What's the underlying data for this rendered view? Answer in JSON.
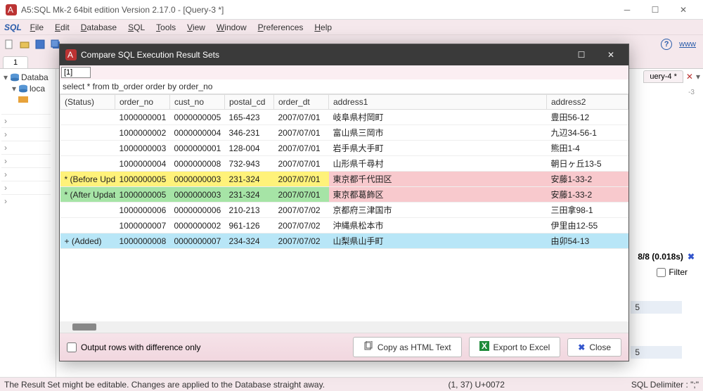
{
  "window": {
    "title": "A5:SQL Mk-2 64bit edition Version 2.17.0 - [Query-3 *]"
  },
  "menu": {
    "file": "File",
    "edit": "Edit",
    "database": "Database",
    "sql": "SQL",
    "tools": "Tools",
    "view": "View",
    "window": "Window",
    "preferences": "Preferences",
    "help": "Help"
  },
  "toolbar": {
    "link_www": "www"
  },
  "tabs": {
    "tab1": "1"
  },
  "right": {
    "tab": "uery-4 *",
    "ruler": "-3",
    "meta": "8/8 (0.018s)",
    "filter": "Filter",
    "val5a": "5",
    "val5b": "5"
  },
  "tree": {
    "root": "Databa",
    "child1": "loca"
  },
  "status": {
    "msg": "The Result Set might be editable. Changes are applied to the Database straight away.",
    "pos": "(1, 37) U+0072",
    "delim": "SQL Delimiter : \";\""
  },
  "dialog": {
    "title": "Compare SQL Execution Result Sets",
    "index": "[1]",
    "sql": "select * from tb_order order by order_no",
    "diff_only": "Output rows with difference only",
    "btn_copy": "Copy as HTML Text",
    "btn_excel": "Export to Excel",
    "btn_close": "Close",
    "cols": [
      "(Status)",
      "order_no",
      "cust_no",
      "postal_cd",
      "order_dt",
      "address1",
      "address2"
    ],
    "rows": [
      {
        "status": "",
        "order_no": "1000000001",
        "cust_no": "0000000005",
        "postal_cd": "165-423",
        "order_dt": "2007/07/01",
        "address1": "岐阜県村岡町",
        "address2": "豊田56-12",
        "cls": ""
      },
      {
        "status": "",
        "order_no": "1000000002",
        "cust_no": "0000000004",
        "postal_cd": "346-231",
        "order_dt": "2007/07/01",
        "address1": "富山県三岡市",
        "address2": "九辺34-56-1",
        "cls": ""
      },
      {
        "status": "",
        "order_no": "1000000003",
        "cust_no": "0000000001",
        "postal_cd": "128-004",
        "order_dt": "2007/07/01",
        "address1": "岩手県大手町",
        "address2": "熊田1-4",
        "cls": ""
      },
      {
        "status": "",
        "order_no": "1000000004",
        "cust_no": "0000000008",
        "postal_cd": "732-943",
        "order_dt": "2007/07/01",
        "address1": "山形県千尋村",
        "address2": "朝日ヶ丘13-5",
        "cls": ""
      },
      {
        "status": "* (Before Upd.",
        "order_no": "1000000005",
        "cust_no": "0000000003",
        "postal_cd": "231-324",
        "order_dt": "2007/07/01",
        "address1": "東京都千代田区",
        "address2": "安藤1-33-2",
        "cls": "row-before"
      },
      {
        "status": "* (After Updat",
        "order_no": "1000000005",
        "cust_no": "0000000003",
        "postal_cd": "231-324",
        "order_dt": "2007/07/01",
        "address1": "東京都葛飾区",
        "address2": "安藤1-33-2",
        "cls": "row-after"
      },
      {
        "status": "",
        "order_no": "1000000006",
        "cust_no": "0000000006",
        "postal_cd": "210-213",
        "order_dt": "2007/07/02",
        "address1": "京都府三津国市",
        "address2": "三田拿98-1",
        "cls": ""
      },
      {
        "status": "",
        "order_no": "1000000007",
        "cust_no": "0000000002",
        "postal_cd": "961-126",
        "order_dt": "2007/07/02",
        "address1": "沖縄県松本市",
        "address2": "伊里由12-55",
        "cls": ""
      },
      {
        "status": "+ (Added)",
        "order_no": "1000000008",
        "cust_no": "0000000007",
        "postal_cd": "234-324",
        "order_dt": "2007/07/02",
        "address1": "山梨県山手町",
        "address2": "由卯54-13",
        "cls": "row-added"
      }
    ]
  },
  "colors": {
    "accent": "#2a5caa"
  }
}
